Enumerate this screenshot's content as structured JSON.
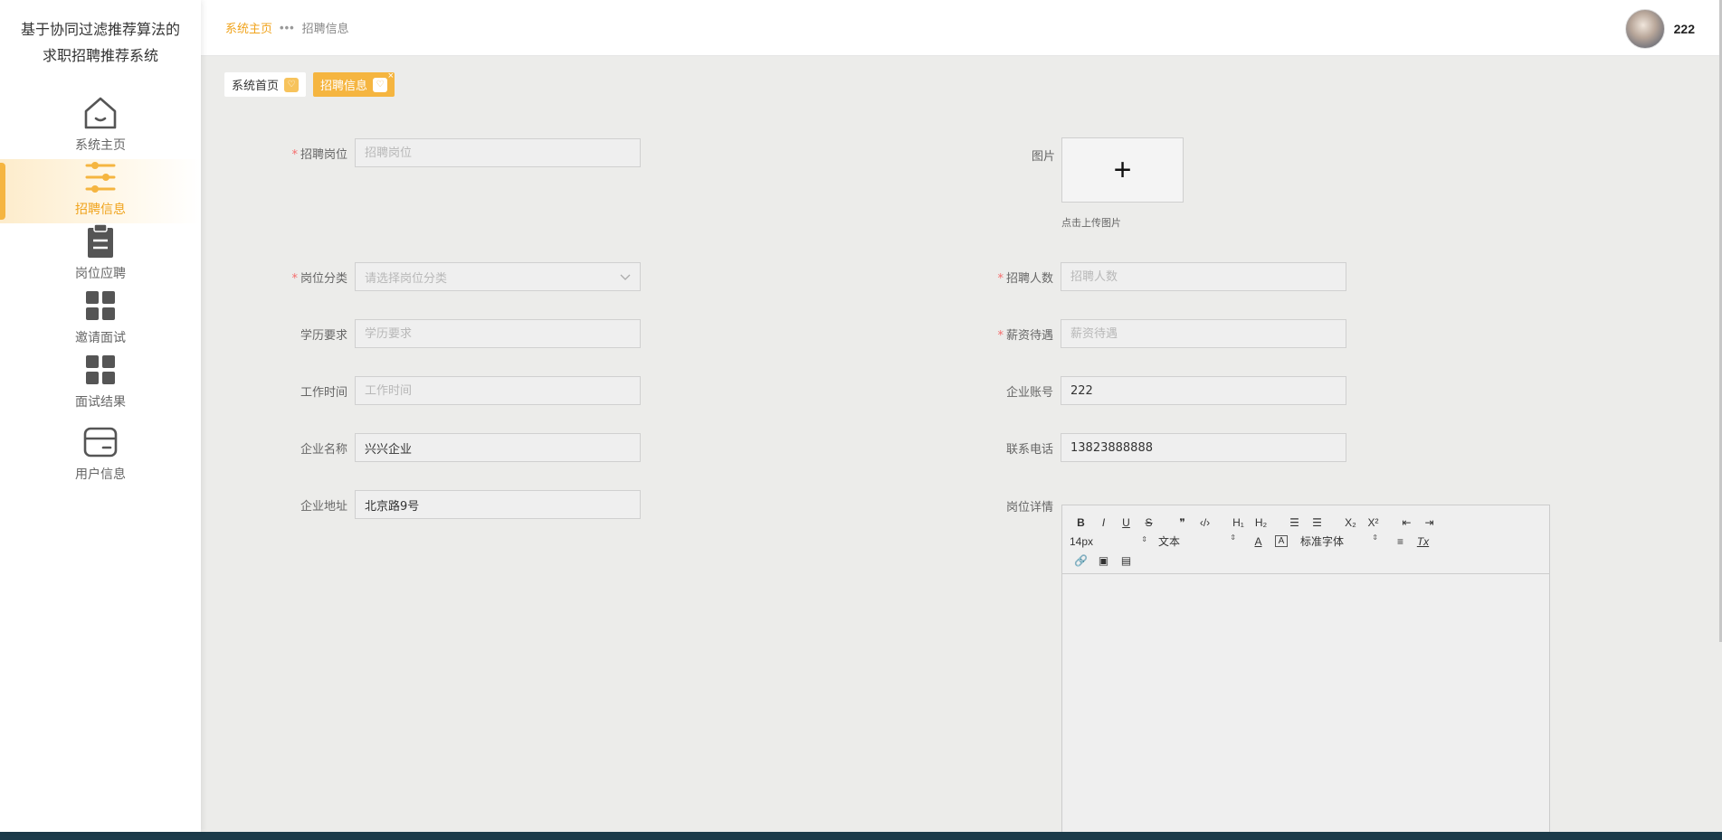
{
  "app": {
    "title_line1": "基于协同过滤推荐算法的",
    "title_line2": "求职招聘推荐系统"
  },
  "sidebar": {
    "items": [
      {
        "label": "系统主页",
        "icon": "home-icon",
        "active": false
      },
      {
        "label": "招聘信息",
        "icon": "sliders-icon",
        "active": true
      },
      {
        "label": "岗位应聘",
        "icon": "clipboard-icon",
        "active": false
      },
      {
        "label": "邀请面试",
        "icon": "grid-icon",
        "active": false
      },
      {
        "label": "面试结果",
        "icon": "grid-icon",
        "active": false
      },
      {
        "label": "用户信息",
        "icon": "card-icon",
        "active": false
      }
    ]
  },
  "header": {
    "breadcrumb_home": "系统主页",
    "breadcrumb_sep": "•••",
    "breadcrumb_current": "招聘信息",
    "username": "222"
  },
  "tabs": [
    {
      "label": "系统首页",
      "active": false
    },
    {
      "label": "招聘信息",
      "active": true,
      "close": "×"
    }
  ],
  "form": {
    "position": {
      "label": "招聘岗位",
      "placeholder": "招聘岗位",
      "value": ""
    },
    "category": {
      "label": "岗位分类",
      "placeholder": "请选择岗位分类"
    },
    "education": {
      "label": "学历要求",
      "placeholder": "学历要求",
      "value": ""
    },
    "work_time": {
      "label": "工作时间",
      "placeholder": "工作时间",
      "value": ""
    },
    "company_name": {
      "label": "企业名称",
      "value": "兴兴企业"
    },
    "company_address": {
      "label": "企业地址",
      "value": "北京路9号"
    },
    "image": {
      "label": "图片",
      "hint": "点击上传图片",
      "plus": "+"
    },
    "headcount": {
      "label": "招聘人数",
      "placeholder": "招聘人数",
      "value": ""
    },
    "salary": {
      "label": "薪资待遇",
      "placeholder": "薪资待遇",
      "value": ""
    },
    "company_account": {
      "label": "企业账号",
      "value": "222"
    },
    "phone": {
      "label": "联系电话",
      "value": "13823888888"
    },
    "details": {
      "label": "岗位详情"
    },
    "required_mark": "*"
  },
  "editor": {
    "font_size": "14px",
    "text_type": "文本",
    "font_family": "标准字体",
    "buttons": {
      "bold": "B",
      "italic": "I",
      "underline": "U",
      "strike": "S",
      "quote": "❞",
      "code": "‹/›",
      "h1": "H₁",
      "h2": "H₂",
      "ol": "☰",
      "ul": "☰",
      "sub": "X₂",
      "sup": "X²",
      "outdent": "⇤",
      "indent": "⇥",
      "color": "A",
      "bg": "A",
      "align": "≡",
      "clean": "Tx",
      "link": "🔗",
      "image": "▣",
      "video": "▤"
    }
  }
}
